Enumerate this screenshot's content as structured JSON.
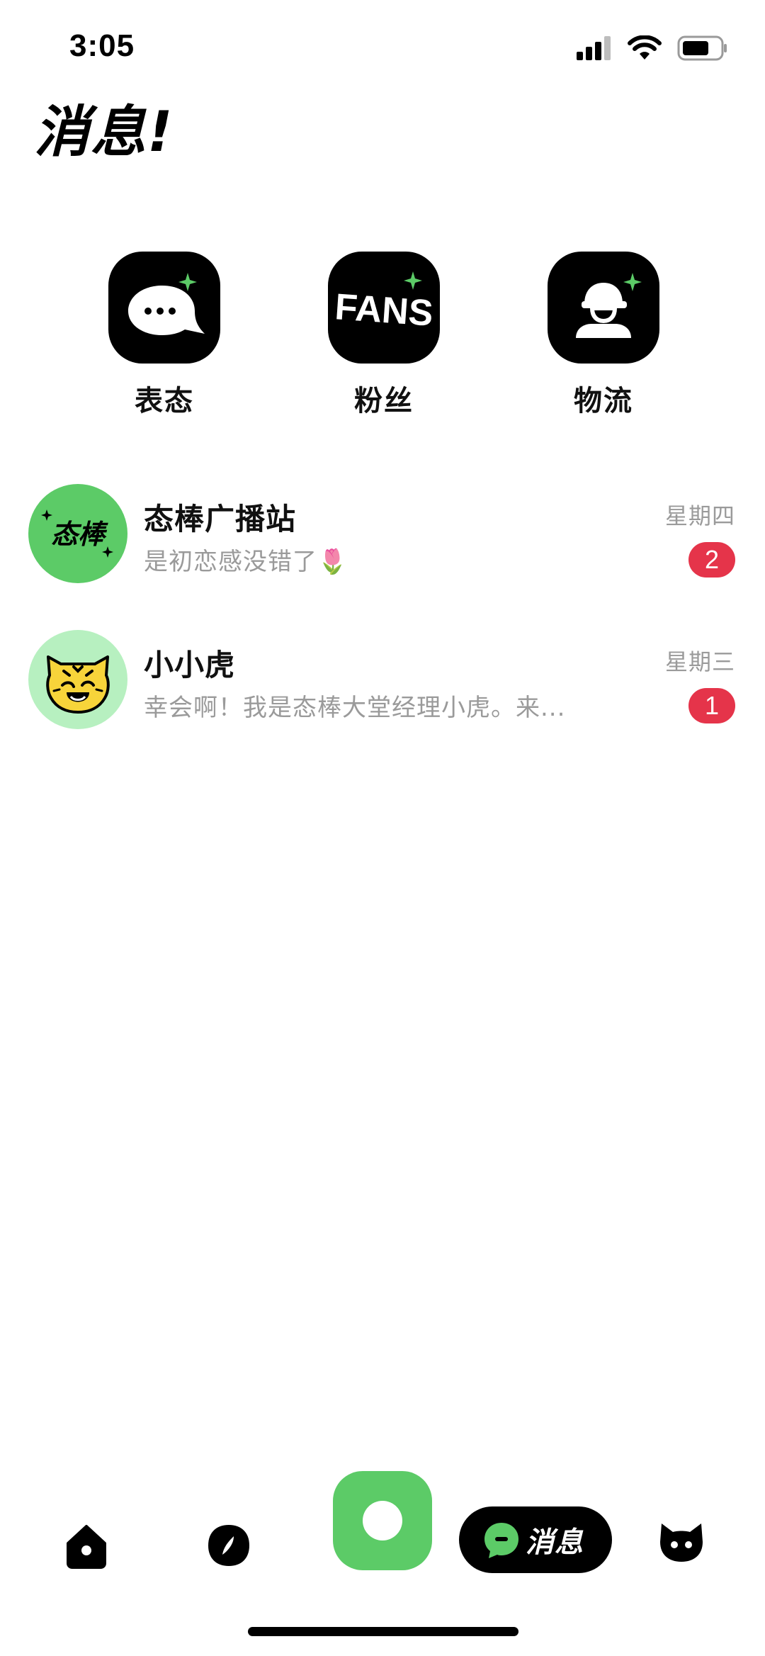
{
  "status_bar": {
    "time": "3:05",
    "icons": [
      "signal-icon",
      "wifi-icon",
      "battery-icon"
    ]
  },
  "page": {
    "title": "消息!"
  },
  "quick_entries": [
    {
      "label": "表态",
      "icon": "chat-bubble-icon"
    },
    {
      "label": "粉丝",
      "icon": "fans-icon",
      "icon_text": "FANS"
    },
    {
      "label": "物流",
      "icon": "courier-icon"
    }
  ],
  "messages": [
    {
      "name": "态棒广播站",
      "preview": "是初恋感没错了🌷",
      "time": "星期四",
      "unread": "2",
      "avatar_text": "态棒",
      "avatar_color": "#5ccb67"
    },
    {
      "name": "小小虎",
      "preview": "幸会啊！我是态棒大堂经理小虎。来...",
      "time": "星期三",
      "unread": "1",
      "avatar_icon": "tiger-icon",
      "avatar_color": "#b7f0c0"
    }
  ],
  "bottom_nav": {
    "items": [
      "home-icon",
      "discover-icon",
      "publish-icon",
      "messages",
      "profile-cat-icon"
    ],
    "active_label": "消息"
  },
  "colors": {
    "accent_green": "#5ccb67",
    "badge_red": "#e5344a",
    "muted_text": "#9a9a9a"
  }
}
